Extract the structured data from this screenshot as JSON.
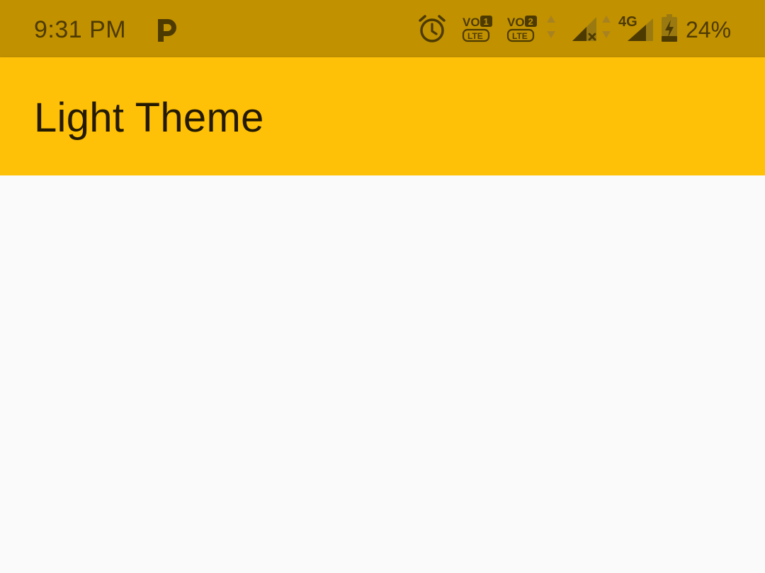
{
  "status_bar": {
    "time": "9:31 PM",
    "app_icon": "parking-p-icon",
    "icons": [
      "alarm-icon",
      "volte-sim1-icon",
      "volte-sim2-icon",
      "data-arrows-icon",
      "signal-sim1-icon",
      "data-arrows-icon",
      "signal-4g-sim2-icon",
      "battery-charging-icon"
    ],
    "network_type": "4G",
    "volte_label": "VO",
    "lte_label": "LTE",
    "sim1": "1",
    "sim2": "2",
    "battery_percent": "24%"
  },
  "app_bar": {
    "title": "Light Theme"
  },
  "colors": {
    "status_bar": "#c19100",
    "app_bar": "#ffc107",
    "background": "#fafafa",
    "title_text": "#241a00",
    "status_text": "#4d3a00"
  }
}
